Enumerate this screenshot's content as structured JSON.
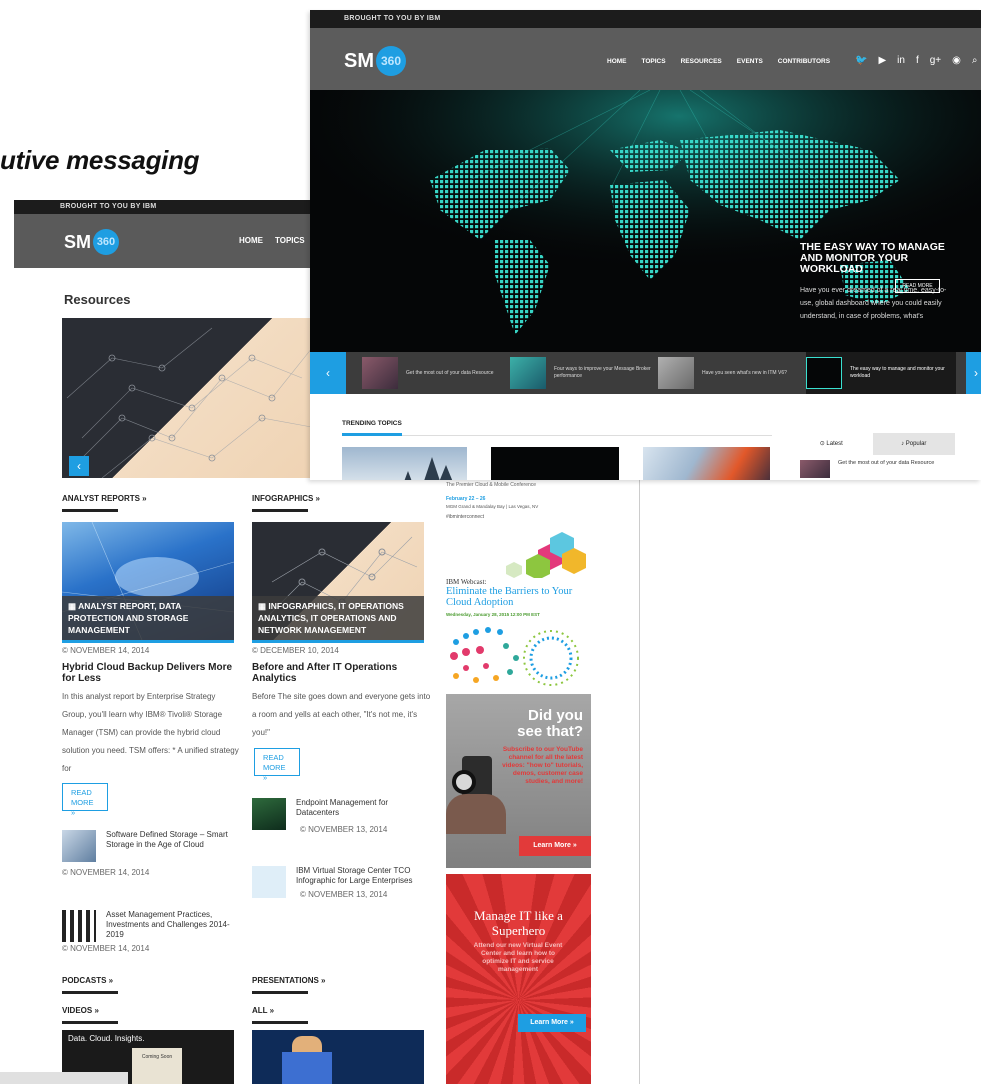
{
  "slide": {
    "caption": "utive messaging"
  },
  "back_page": {
    "brought_by": "BROUGHT TO YOU BY IBM",
    "logo": {
      "text": "SM",
      "badge": "360"
    },
    "nav": [
      "HOME",
      "TOPICS"
    ],
    "page_title": "Resources",
    "hero_prev": "‹",
    "sections": {
      "analyst_reports": "ANALYST REPORTS »",
      "infographics": "INFOGRAPHICS »",
      "podcasts": "PODCASTS »",
      "presentations": "PRESENTATIONS »",
      "videos": "VIDEOS »",
      "all": "ALL »"
    },
    "featured": [
      {
        "caption": "ANALYST REPORT, DATA PROTECTION AND STORAGE MANAGEMENT",
        "date": "© NOVEMBER 14, 2014",
        "title": "Hybrid Cloud Backup Delivers More for Less",
        "body": "In this analyst report by Enterprise Strategy Group, you'll learn why IBM® Tivoli® Storage Manager (TSM) can provide the hybrid cloud solution you need. TSM offers: * A unified strategy for",
        "read_more": "READ MORE »"
      },
      {
        "caption": "INFOGRAPHICS, IT OPERATIONS ANALYTICS, IT OPERATIONS AND NETWORK MANAGEMENT",
        "date": "© DECEMBER 10, 2014",
        "title": "Before and After IT Operations Analytics",
        "body": "Before The site goes down and everyone gets into a room and yells at each other, \"It's not me, it's you!\"",
        "read_more": "READ MORE »"
      }
    ],
    "list_left": [
      {
        "title": "Software Defined Storage – Smart Storage in the Age of Cloud",
        "date": "© NOVEMBER 14, 2014"
      },
      {
        "title": "Asset Management Practices, Investments and Challenges 2014-2019",
        "date": "© NOVEMBER 14, 2014"
      }
    ],
    "list_right": [
      {
        "title": "Endpoint Management for Datacenters",
        "date": "© NOVEMBER 13, 2014"
      },
      {
        "title": "IBM Virtual Storage Center TCO Infographic for Large Enterprises",
        "date": "© NOVEMBER 13, 2014"
      }
    ],
    "video_thumb": {
      "title": "Data. Cloud. Insights.",
      "sub": "Coming Soon"
    },
    "ads": {
      "interconnect": {
        "subtitle": "The Premier Cloud & Mobile Conference",
        "dates": "February 22 – 26",
        "venue": "MGM Grand & Mandalay Bay | Las Vegas, NV",
        "hashtag": "#ibminterconnect"
      },
      "webcast": {
        "label": "IBM Webcast:",
        "title": "Eliminate the Barriers to Your Cloud Adoption",
        "date": "Wednesday, January 28, 2015 12:00 PM EST"
      },
      "video": {
        "headline": "Did you see that?",
        "body": "Subscribe to our YouTube channel for all the latest videos: \"how to\" tutorials, demos, customer case studies, and more!",
        "cta": "Learn More »"
      },
      "superhero": {
        "headline": "Manage IT like a Superhero",
        "body": "Attend our new Virtual Event Center and learn how to optimize IT and service management",
        "cta": "Learn More »"
      }
    }
  },
  "front_page": {
    "brought_by": "BROUGHT TO YOU BY IBM",
    "logo": {
      "text": "SM",
      "badge": "360"
    },
    "nav": [
      "HOME",
      "TOPICS",
      "RESOURCES",
      "EVENTS",
      "CONTRIBUTORS"
    ],
    "social_icons": [
      "twitter-icon",
      "youtube-icon",
      "linkedin-icon",
      "facebook-icon",
      "googleplus-icon",
      "rss-icon",
      "search-icon"
    ],
    "social_glyphs": [
      "🐦",
      "▶",
      "in",
      "f",
      "g+",
      "◉",
      "⌕"
    ],
    "hero": {
      "title": "THE EASY WAY TO MANAGE AND MONITOR YOUR WORKLOAD",
      "body": "Have you ever dreamed of a real time, easy-to-use, global dashboard where you could easily understand, in case of problems, what's",
      "button": "READ MORE"
    },
    "carousel": {
      "prev": "‹",
      "next": "›",
      "items": [
        "Get the most out of your data Resource",
        "Four ways to improve your Message Broker performance",
        "Have you seen what's new in ITM V6?",
        "The easy way to manage and monitor your workload"
      ]
    },
    "trending_label": "TRENDING TOPICS",
    "tabs": {
      "latest": "⊙ Latest",
      "popular": "♪ Popular"
    },
    "latest_item": "Get the most out of your data Resource"
  },
  "colors": {
    "accent": "#1e9ee2",
    "header": "#5c5c5c",
    "ad_red": "#e23a3a"
  }
}
